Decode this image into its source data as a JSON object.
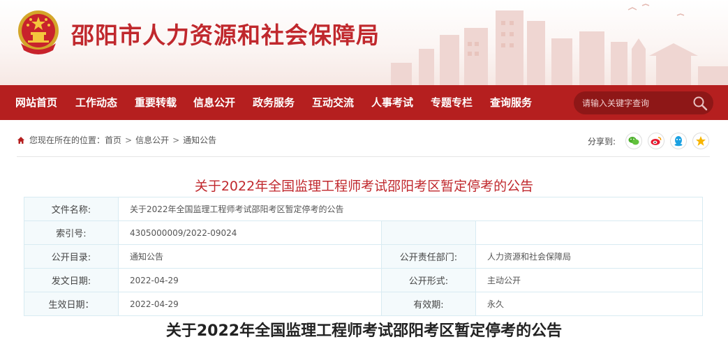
{
  "header": {
    "site_title": "邵阳市人力资源和社会保障局"
  },
  "nav": {
    "items": [
      {
        "label": "网站首页"
      },
      {
        "label": "工作动态"
      },
      {
        "label": "重要转载"
      },
      {
        "label": "信息公开"
      },
      {
        "label": "政务服务"
      },
      {
        "label": "互动交流"
      },
      {
        "label": "人事考试"
      },
      {
        "label": "专题专栏"
      },
      {
        "label": "查询服务"
      }
    ],
    "search_placeholder": "请输入关键字查询"
  },
  "breadcrumb": {
    "prefix": "您现在所在的位置：",
    "items": [
      "首页",
      "信息公开",
      "通知公告"
    ],
    "separator": ">"
  },
  "share": {
    "label": "分享到:",
    "buttons": [
      "wechat-icon",
      "weibo-icon",
      "qq-icon",
      "qzone-icon"
    ]
  },
  "document": {
    "title": "关于2022年全国监理工程师考试邵阳考区暂定停考的公告",
    "article_title": "关于2022年全国监理工程师考试邵阳考区暂定停考的公告"
  },
  "info_table": {
    "file_name_label": "文件名称:",
    "file_name_value": "关于2022年全国监理工程师考试邵阳考区暂定停考的公告",
    "index_label": "索引号:",
    "index_value": "4305000009/2022-09024",
    "catalog_label": "公开目录:",
    "catalog_value": "通知公告",
    "dept_label": "公开责任部门:",
    "dept_value": "人力资源和社会保障局",
    "issue_date_label": "发文日期:",
    "issue_date_value": "2022-04-29",
    "form_label": "公开形式:",
    "form_value": "主动公开",
    "effective_date_label": "生效日期：",
    "effective_date_value": "2022-04-29",
    "validity_label": "有效期:",
    "validity_value": "永久"
  },
  "colors": {
    "brand_red": "#b51f1f",
    "title_red": "#c0282d"
  }
}
